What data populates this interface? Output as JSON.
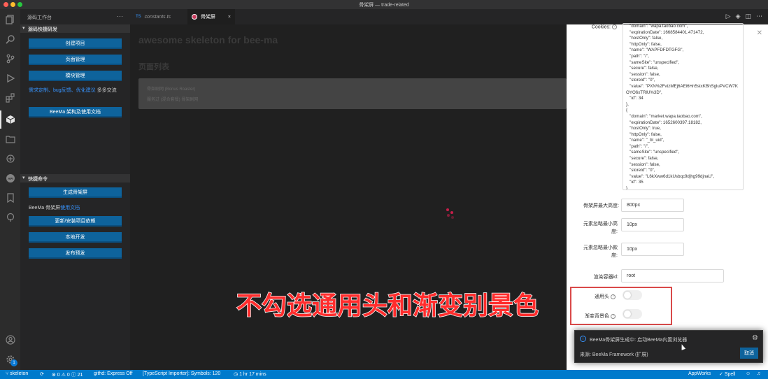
{
  "window": {
    "title": "骨架屏 — trade-related"
  },
  "sidebar": {
    "title": "源码工作台",
    "more": "···",
    "section1": "源码快捷研发",
    "btn_create": "创建项目",
    "btn_page": "页面管理",
    "btn_module": "模块管理",
    "feedback_link": "需求定制、bug反馈、优化建议",
    "feedback_text": "多多交流",
    "btn_docs": "BeeMa 架构及使用文档",
    "section2": "快捷命令",
    "btn_skeleton": "生成骨架屏",
    "skeleton_prefix": "BeeMa 骨架屏",
    "skeleton_link": "使用文档",
    "btn_deps": "更新/安装项目依赖",
    "btn_dev": "本地开发",
    "btn_publish": "发布预发"
  },
  "tabs": {
    "tab1_icon": "TS",
    "tab1_label": "constants.ts",
    "tab2_label": "骨架屏",
    "tab2_close": "×"
  },
  "webview": {
    "title": "awesome skeleton for bee-ma",
    "subtitle": "页面列表",
    "card_line1": "骨架剧网 (Bonus Roaster)",
    "card_line2": "服务过 (混合套餐) 骨架剧网"
  },
  "panel": {
    "cookies_label": "Cookies:",
    "cookies_text": "   \"domain\": \"wapa.taobao.com\",\n   \"expirationDate\": 1668584401.471472,\n   \"hostOnly\": false,\n   \"httpOnly\": false,\n   \"name\": \"WAPFDFDTGFG\",\n   \"path\": \"/\",\n   \"sameSite\": \"unspecified\",\n   \"secure\": false,\n   \"session\": false,\n   \"storeId\": \"0\",\n   \"value\": \"PXN%2FvtzMEj6AEi6Hn5stxKBhSgluPVCW7KOYO6xTRlU%3D\",\n   \"id\": 34\n},\n{\n   \"domain\": \"market.wapa.taobao.com\",\n   \"expirationDate\": 1652600397.18182,\n   \"hostOnly\": true,\n   \"httpOnly\": false,\n   \"name\": \"_bl_uid\",\n   \"path\": \"/\",\n   \"sameSite\": \"unspecified\",\n   \"secure\": false,\n   \"session\": false,\n   \"storeId\": \"0\",\n   \"value\": \"L6kXww6d1kUsbqc9djhg99djnaU\",\n   \"id\": 35\n}\n]",
    "max_height_label": "骨架屏最大高度:",
    "max_height_value": "800px",
    "min_height_label1": "元素忽略最小高",
    "min_height_label2": "度:",
    "min_height_value": "10px",
    "min_width_label1": "元素忽略最小款",
    "min_width_label2": "度:",
    "min_width_value": "10px",
    "container_label": "渲染容器id:",
    "container_value": "root",
    "common_header_label": "通用头",
    "gradient_bg_label": "渐变背景色",
    "common_header_on": false,
    "gradient_bg_on": false
  },
  "caption": "不勾选通用头和渐变别景色",
  "notification": {
    "message": "BeeMa骨架屏生成中: 启动BeeMa内置浏览器",
    "source": "来源: BeeMa Framework (扩展)",
    "cancel": "取消"
  },
  "statusbar": {
    "branch": "skeleton",
    "problems": "⊗ 0 ⚠ 0 ⓘ 21",
    "githd": "githd: Express Off",
    "ts_importer": "[TypeScript Importer]: Symbols: 120",
    "time": "1 hr 17 mins",
    "appworks": "AppWorks",
    "spell": "Spell"
  },
  "activity": {
    "badge": "1"
  },
  "colors": {
    "accent": "#007acc",
    "button": "#0e639c",
    "highlight": "#d94a4a",
    "caption": "#ff2d2d"
  }
}
